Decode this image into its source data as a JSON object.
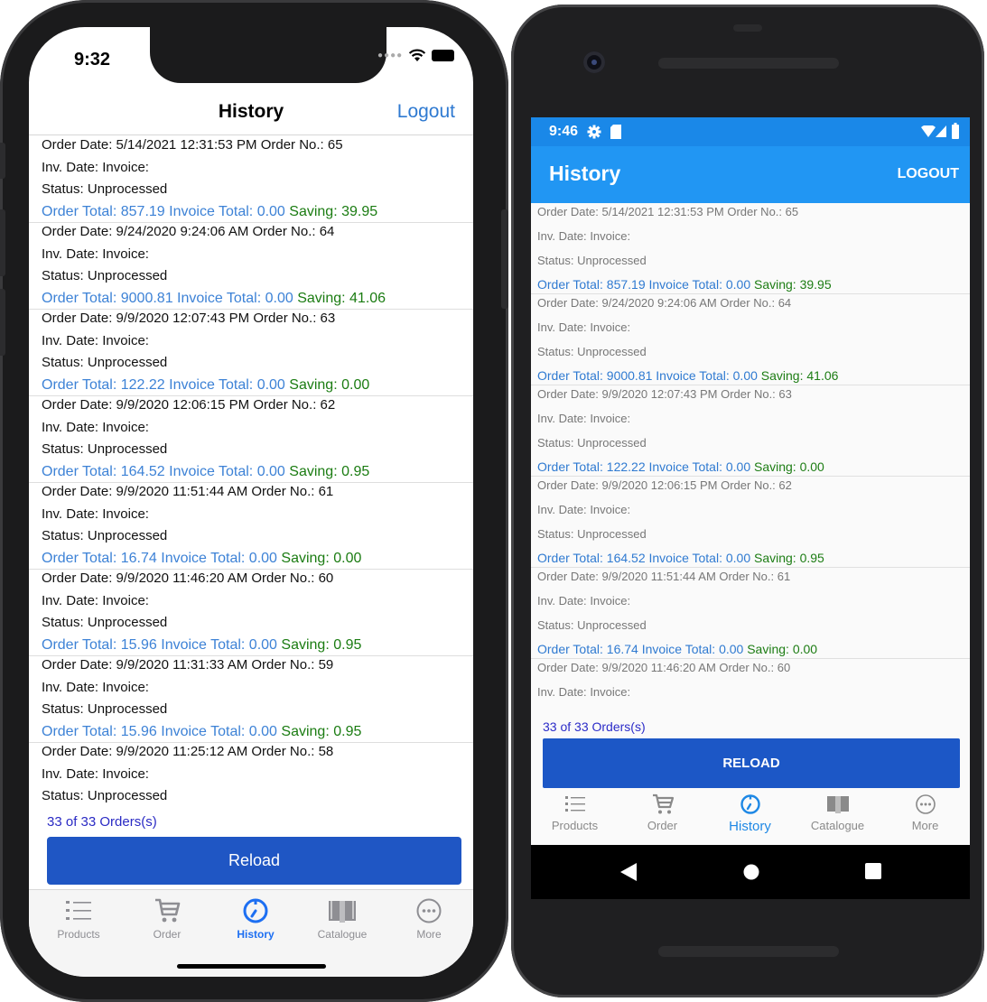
{
  "ios": {
    "time": "9:32",
    "nav_title": "History",
    "logout": "Logout",
    "orders": [
      {
        "order_date_label": "Order Date:",
        "order_date": "5/14/2021 12:31:53 PM",
        "order_no_label": "Order No.:",
        "order_no": "65",
        "inv_date_label": "Inv. Date:",
        "invoice_label": "Invoice:",
        "status_label": "Status:",
        "status": "Unprocessed",
        "order_total_label": "Order Total:",
        "order_total": "857.19",
        "invoice_total_label": "Invoice Total:",
        "invoice_total": "0.00",
        "saving_label": "Saving:",
        "saving": "39.95"
      },
      {
        "order_date_label": "Order Date:",
        "order_date": "9/24/2020 9:24:06 AM",
        "order_no_label": "Order No.:",
        "order_no": "64",
        "inv_date_label": "Inv. Date:",
        "invoice_label": "Invoice:",
        "status_label": "Status:",
        "status": "Unprocessed",
        "order_total_label": "Order Total:",
        "order_total": "9000.81",
        "invoice_total_label": "Invoice Total:",
        "invoice_total": "0.00",
        "saving_label": "Saving:",
        "saving": "41.06"
      },
      {
        "order_date_label": "Order Date:",
        "order_date": "9/9/2020 12:07:43 PM",
        "order_no_label": "Order No.:",
        "order_no": "63",
        "inv_date_label": "Inv. Date:",
        "invoice_label": "Invoice:",
        "status_label": "Status:",
        "status": "Unprocessed",
        "order_total_label": "Order Total:",
        "order_total": "122.22",
        "invoice_total_label": "Invoice Total:",
        "invoice_total": "0.00",
        "saving_label": "Saving:",
        "saving": "0.00"
      },
      {
        "order_date_label": "Order Date:",
        "order_date": "9/9/2020 12:06:15 PM",
        "order_no_label": "Order No.:",
        "order_no": "62",
        "inv_date_label": "Inv. Date:",
        "invoice_label": "Invoice:",
        "status_label": "Status:",
        "status": "Unprocessed",
        "order_total_label": "Order Total:",
        "order_total": "164.52",
        "invoice_total_label": "Invoice Total:",
        "invoice_total": "0.00",
        "saving_label": "Saving:",
        "saving": "0.95"
      },
      {
        "order_date_label": "Order Date:",
        "order_date": "9/9/2020 11:51:44 AM",
        "order_no_label": "Order No.:",
        "order_no": "61",
        "inv_date_label": "Inv. Date:",
        "invoice_label": "Invoice:",
        "status_label": "Status:",
        "status": "Unprocessed",
        "order_total_label": "Order Total:",
        "order_total": "16.74",
        "invoice_total_label": "Invoice Total:",
        "invoice_total": "0.00",
        "saving_label": "Saving:",
        "saving": "0.00"
      },
      {
        "order_date_label": "Order Date:",
        "order_date": "9/9/2020 11:46:20 AM",
        "order_no_label": "Order No.:",
        "order_no": "60",
        "inv_date_label": "Inv. Date:",
        "invoice_label": "Invoice:",
        "status_label": "Status:",
        "status": "Unprocessed",
        "order_total_label": "Order Total:",
        "order_total": "15.96",
        "invoice_total_label": "Invoice Total:",
        "invoice_total": "0.00",
        "saving_label": "Saving:",
        "saving": "0.95"
      },
      {
        "order_date_label": "Order Date:",
        "order_date": "9/9/2020 11:31:33 AM",
        "order_no_label": "Order No.:",
        "order_no": "59",
        "inv_date_label": "Inv. Date:",
        "invoice_label": "Invoice:",
        "status_label": "Status:",
        "status": "Unprocessed",
        "order_total_label": "Order Total:",
        "order_total": "15.96",
        "invoice_total_label": "Invoice Total:",
        "invoice_total": "0.00",
        "saving_label": "Saving:",
        "saving": "0.95"
      },
      {
        "order_date_label": "Order Date:",
        "order_date": "9/9/2020 11:25:12 AM",
        "order_no_label": "Order No.:",
        "order_no": "58",
        "inv_date_label": "Inv. Date:",
        "invoice_label": "Invoice:",
        "status_label": "Status:",
        "status": "Unprocessed"
      }
    ],
    "count": "33 of 33 Orders(s)",
    "reload": "Reload",
    "tabs": [
      {
        "label": "Products",
        "icon": "list-icon"
      },
      {
        "label": "Order",
        "icon": "cart-icon"
      },
      {
        "label": "History",
        "icon": "clock-icon"
      },
      {
        "label": "Catalogue",
        "icon": "book-icon"
      },
      {
        "label": "More",
        "icon": "more-icon"
      }
    ],
    "active_tab": "History"
  },
  "android": {
    "time": "9:46",
    "title": "History",
    "logout": "LOGOUT",
    "orders": [
      {
        "order_date_label": "Order Date:",
        "order_date": "5/14/2021 12:31:53 PM",
        "order_no_label": "Order No.:",
        "order_no": "65",
        "inv_date_label": "Inv. Date:",
        "invoice_label": "Invoice:",
        "status_label": "Status:",
        "status": "Unprocessed",
        "order_total_label": "Order Total:",
        "order_total": "857.19",
        "invoice_total_label": "Invoice Total:",
        "invoice_total": "0.00",
        "saving_label": "Saving:",
        "saving": "39.95"
      },
      {
        "order_date_label": "Order Date:",
        "order_date": "9/24/2020 9:24:06 AM",
        "order_no_label": "Order No.:",
        "order_no": "64",
        "inv_date_label": "Inv. Date:",
        "invoice_label": "Invoice:",
        "status_label": "Status:",
        "status": "Unprocessed",
        "order_total_label": "Order Total:",
        "order_total": "9000.81",
        "invoice_total_label": "Invoice Total:",
        "invoice_total": "0.00",
        "saving_label": "Saving:",
        "saving": "41.06"
      },
      {
        "order_date_label": "Order Date:",
        "order_date": "9/9/2020 12:07:43 PM",
        "order_no_label": "Order No.:",
        "order_no": "63",
        "inv_date_label": "Inv. Date:",
        "invoice_label": "Invoice:",
        "status_label": "Status:",
        "status": "Unprocessed",
        "order_total_label": "Order Total:",
        "order_total": "122.22",
        "invoice_total_label": "Invoice Total:",
        "invoice_total": "0.00",
        "saving_label": "Saving:",
        "saving": "0.00"
      },
      {
        "order_date_label": "Order Date:",
        "order_date": "9/9/2020 12:06:15 PM",
        "order_no_label": "Order No.:",
        "order_no": "62",
        "inv_date_label": "Inv. Date:",
        "invoice_label": "Invoice:",
        "status_label": "Status:",
        "status": "Unprocessed",
        "order_total_label": "Order Total:",
        "order_total": "164.52",
        "invoice_total_label": "Invoice Total:",
        "invoice_total": "0.00",
        "saving_label": "Saving:",
        "saving": "0.95"
      },
      {
        "order_date_label": "Order Date:",
        "order_date": "9/9/2020 11:51:44 AM",
        "order_no_label": "Order No.:",
        "order_no": "61",
        "inv_date_label": "Inv. Date:",
        "invoice_label": "Invoice:",
        "status_label": "Status:",
        "status": "Unprocessed",
        "order_total_label": "Order Total:",
        "order_total": "16.74",
        "invoice_total_label": "Invoice Total:",
        "invoice_total": "0.00",
        "saving_label": "Saving:",
        "saving": "0.00"
      },
      {
        "order_date_label": "Order Date:",
        "order_date": "9/9/2020 11:46:20 AM",
        "order_no_label": "Order No.:",
        "order_no": "60",
        "inv_date_label": "Inv. Date:",
        "invoice_label": "Invoice:"
      }
    ],
    "count": "33 of 33 Orders(s)",
    "reload": "RELOAD",
    "tabs": [
      {
        "label": "Products",
        "icon": "list-icon"
      },
      {
        "label": "Order",
        "icon": "cart-icon"
      },
      {
        "label": "History",
        "icon": "clock-icon"
      },
      {
        "label": "Catalogue",
        "icon": "book-icon"
      },
      {
        "label": "More",
        "icon": "more-icon"
      }
    ],
    "active_tab": "History"
  },
  "colors": {
    "ios_accent": "#2f7ad1",
    "ios_button": "#1f56c4",
    "android_appbar": "#2196f3",
    "android_button": "#1c57c6",
    "saving_green": "#1b7c12",
    "total_blue": "#3d82d6",
    "count_text": "#2a2ac4"
  }
}
